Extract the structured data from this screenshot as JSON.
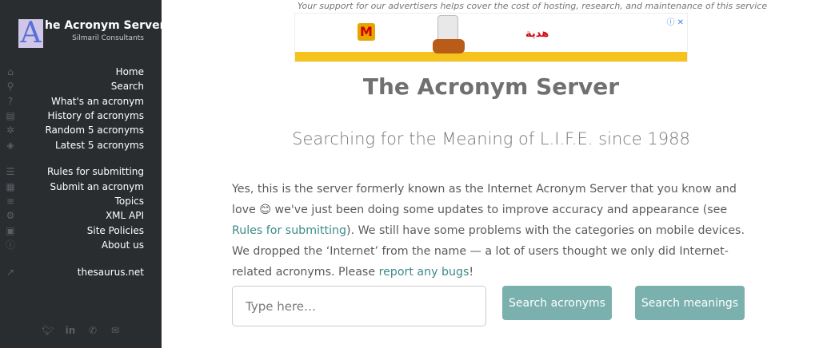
{
  "sidebar": {
    "logo_letter": "A",
    "title": "he Acronym Server",
    "subtitle": "Silmaril Consultants",
    "items": [
      {
        "label": "Home",
        "icon": "home-icon"
      },
      {
        "label": "Search",
        "icon": "search-icon"
      },
      {
        "label": "What's an acronym",
        "icon": "question-icon"
      },
      {
        "label": "History of acronyms",
        "icon": "book-icon"
      },
      {
        "label": "Random 5 acronyms",
        "icon": "gear-icon"
      },
      {
        "label": "Latest 5 acronyms",
        "icon": "tags-icon"
      },
      {
        "label": "Rules for submitting",
        "icon": "list-icon"
      },
      {
        "label": "Submit an acronym",
        "icon": "table-icon"
      },
      {
        "label": "Topics",
        "icon": "list-ol-icon"
      },
      {
        "label": "XML API",
        "icon": "cogs-icon"
      },
      {
        "label": "Site Policies",
        "icon": "lock-icon"
      },
      {
        "label": "About us",
        "icon": "info-icon"
      },
      {
        "label": "thesaurus.net",
        "icon": "external-link-icon"
      }
    ],
    "social": [
      "twitter-icon",
      "linkedin-icon",
      "phone-icon",
      "email-icon"
    ]
  },
  "ad": {
    "note": "Your support for our advertisers helps cover the cost of hosting, research, and maintenance of this service",
    "brand_mark": "M",
    "gift_text": "هدية"
  },
  "main": {
    "title": "The Acronym Server",
    "tagline": "Searching for the Meaning of L.I.F.E. since 1988",
    "intro_part1": "Yes, this is the server formerly known as the Internet Acronym Server that you know and love 😊 we've just been doing some updates to improve accuracy and appearance (see ",
    "intro_link1": "Rules for submitting",
    "intro_part2": "). We still have some problems with the categories on mobile devices. We dropped the ‘Internet’ from the name — a lot of users thought we only did Internet-related acronyms. Please ",
    "intro_link2": "report any bugs",
    "intro_part3": "!"
  },
  "search": {
    "placeholder": "Type here…",
    "btn_acronyms": "Search acronyms",
    "btn_meanings": "Search meanings"
  },
  "colors": {
    "sidebar_bg": "#2a2d30",
    "button_bg": "#7ab0ad",
    "link": "#3d8b8b"
  }
}
